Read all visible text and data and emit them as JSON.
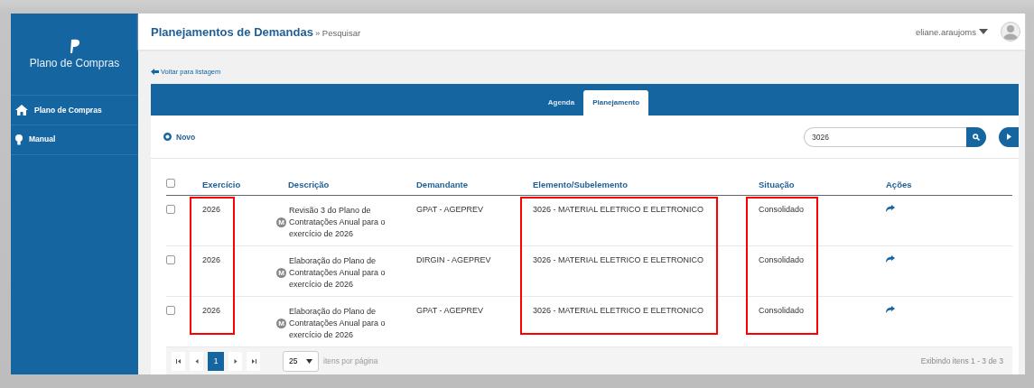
{
  "sidebar": {
    "logo_text": "Plano de Compras",
    "items": [
      {
        "label": "Plano de Compras"
      },
      {
        "label": "Manual"
      }
    ]
  },
  "header": {
    "title": "Planejamentos de Demandas",
    "subtitle": "» Pesquisar",
    "user": "eliane.araujoms"
  },
  "back_link": "Voltar para listagem",
  "tabs": [
    {
      "label": "Agenda",
      "selected": false
    },
    {
      "label": "Planejamento",
      "selected": true
    }
  ],
  "toolbar": {
    "new_button": "Novo",
    "search": {
      "value": "3026"
    }
  },
  "table": {
    "columns": [
      {
        "label": "Exercício",
        "highlighted": true
      },
      {
        "label": "Descrição",
        "highlighted": false
      },
      {
        "label": "Demandante",
        "highlighted": false
      },
      {
        "label": "Elemento/Subelemento",
        "highlighted": true
      },
      {
        "label": "Situação",
        "highlighted": true
      },
      {
        "label": "Ações",
        "highlighted": false
      }
    ],
    "select_all_checked": false,
    "rows": [
      {
        "checked": false,
        "exercicio": "2026",
        "badge": "M",
        "descricao": "Revisão 3 do Plano de Contratações Anual para o exercício de 2026",
        "demandante": "GPAT - AGEPREV",
        "elemento": "3026 - MATERIAL ELETRICO E ELETRONICO",
        "situacao": "Consolidado"
      },
      {
        "checked": false,
        "exercicio": "2026",
        "badge": "M",
        "descricao": "Elaboração do Plano de Contratações Anual para o exercício de 2026",
        "demandante": "DIRGIN - AGEPREV",
        "elemento": "3026 - MATERIAL ELETRICO E ELETRONICO",
        "situacao": "Consolidado"
      },
      {
        "checked": false,
        "exercicio": "2026",
        "badge": "M",
        "descricao": "Elaboração do Plano de Contratações Anual para o exercício de 2026",
        "demandante": "GPAT - AGEPREV",
        "elemento": "3026 - MATERIAL ELETRICO E ELETRONICO",
        "situacao": "Consolidado"
      }
    ]
  },
  "pager": {
    "pages": [
      {
        "label": "1",
        "selected": true
      }
    ],
    "page_size": "25",
    "page_size_label": "itens por página",
    "summary": "Exibindo itens 1 - 3 de 3"
  }
}
